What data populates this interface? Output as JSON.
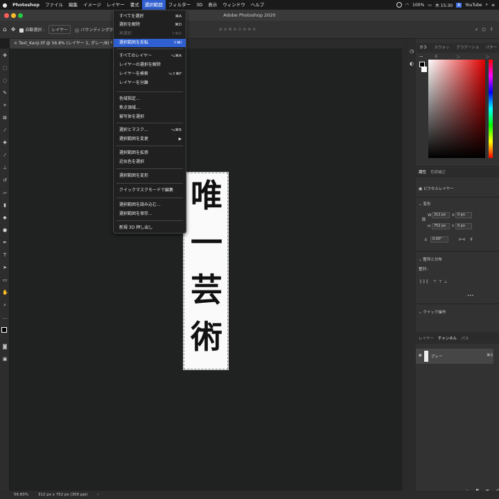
{
  "menubar": {
    "apple": "",
    "items": [
      "Photoshop",
      "ファイル",
      "編集",
      "イメージ",
      "レイヤー",
      "書式",
      "選択範囲",
      "フィルター",
      "3D",
      "表示",
      "ウィンドウ",
      "ヘルプ"
    ],
    "right": {
      "battery": "100%",
      "time": "木 15:30",
      "app": "YouTube"
    }
  },
  "titlebar": {
    "title": "Adobe Photoshop 2020"
  },
  "options": {
    "auto_select": "自動選択 :",
    "layer_mode": "レイヤー",
    "bounding_box": "バウンディングボックスを表示"
  },
  "document": {
    "tab_label": "Text_Kanji.tif @ 56.8% (レイヤー 1, グレー/8) *",
    "characters": [
      "唯",
      "一",
      "芸",
      "術"
    ]
  },
  "menu": {
    "items": [
      {
        "label": "すべてを選択",
        "shortcut": "⌘A",
        "state": "normal"
      },
      {
        "label": "選択を解除",
        "shortcut": "⌘D",
        "state": "normal"
      },
      {
        "label": "再選択",
        "shortcut": "⇧⌘D",
        "state": "dim"
      },
      {
        "label": "選択範囲を反転",
        "shortcut": "⇧⌘I",
        "state": "highlight"
      },
      {
        "label": "すべてのレイヤー",
        "shortcut": "⌥⌘A",
        "state": "normal"
      },
      {
        "label": "レイヤーの選択を解除",
        "shortcut": "",
        "state": "normal"
      },
      {
        "label": "レイヤーを検索",
        "shortcut": "⌥⇧⌘F",
        "state": "normal"
      },
      {
        "label": "レイヤーを分離",
        "shortcut": "",
        "state": "normal"
      },
      {
        "label": "色域指定...",
        "shortcut": "",
        "state": "normal"
      },
      {
        "label": "焦点領域...",
        "shortcut": "",
        "state": "normal"
      },
      {
        "label": "被写体を選択",
        "shortcut": "",
        "state": "normal"
      },
      {
        "label": "選択とマスク...",
        "shortcut": "⌥⌘R",
        "state": "normal"
      },
      {
        "label": "選択範囲を変更",
        "shortcut": "▶",
        "state": "normal"
      },
      {
        "label": "選択範囲を拡張",
        "shortcut": "",
        "state": "normal"
      },
      {
        "label": "近似色を選択",
        "shortcut": "",
        "state": "normal"
      },
      {
        "label": "選択範囲を変形",
        "shortcut": "",
        "state": "normal"
      },
      {
        "label": "クイックマスクモードで編集",
        "shortcut": "",
        "state": "normal"
      },
      {
        "label": "選択範囲を読み込む...",
        "shortcut": "",
        "state": "normal"
      },
      {
        "label": "選択範囲を保存...",
        "shortcut": "",
        "state": "normal"
      },
      {
        "label": "新規 3D 押し出し",
        "shortcut": "",
        "state": "normal"
      }
    ]
  },
  "panels": {
    "color_tabs": [
      "カラー",
      "スウォッチ",
      "グラデーション",
      "パターン"
    ],
    "props_tabs": [
      "属性",
      "色調補正"
    ],
    "pixel_layer": "ピクセルレイヤー",
    "transform_title": "変形",
    "w": "312 px",
    "h": "752 px",
    "x": "0 px",
    "y": "0 px",
    "angle": "0.00°",
    "align_title": "整列と分布",
    "align_label": "整列 :",
    "quick_actions": "クイック操作",
    "layers_tabs": [
      "レイヤー",
      "チャンネル",
      "パス"
    ],
    "channel_name": "グレー",
    "channel_shortcut": "⌘3"
  },
  "status": {
    "zoom": "56.83%",
    "size": "312 px x 752 px (300 ppi)"
  }
}
